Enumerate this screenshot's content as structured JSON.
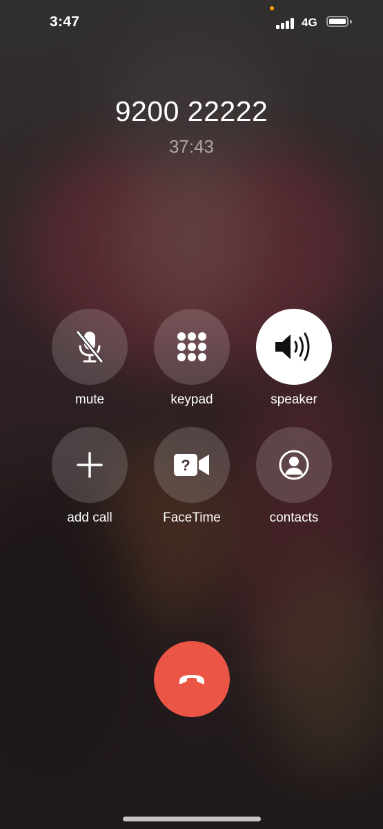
{
  "status_bar": {
    "time": "3:47",
    "network": "4G",
    "signal_bars": 4,
    "battery_level": 0.95,
    "privacy_indicator_color": "#ff9f0a"
  },
  "call": {
    "number": "9200 22222",
    "duration": "37:43"
  },
  "controls": [
    {
      "id": "mute",
      "label": "mute",
      "icon": "mic-slash-icon",
      "active": false
    },
    {
      "id": "keypad",
      "label": "keypad",
      "icon": "keypad-icon",
      "active": false
    },
    {
      "id": "speaker",
      "label": "speaker",
      "icon": "speaker-icon",
      "active": true
    },
    {
      "id": "add-call",
      "label": "add call",
      "icon": "plus-icon",
      "active": false
    },
    {
      "id": "facetime",
      "label": "FaceTime",
      "icon": "video-question-icon",
      "active": false
    },
    {
      "id": "contacts",
      "label": "contacts",
      "icon": "person-circle-icon",
      "active": false
    }
  ],
  "end_call": {
    "icon": "phone-down-icon",
    "color": "#eb5545"
  },
  "colors": {
    "button_bg": "rgba(255,255,255,0.16)",
    "active_button_bg": "#ffffff",
    "text": "#ffffff"
  }
}
